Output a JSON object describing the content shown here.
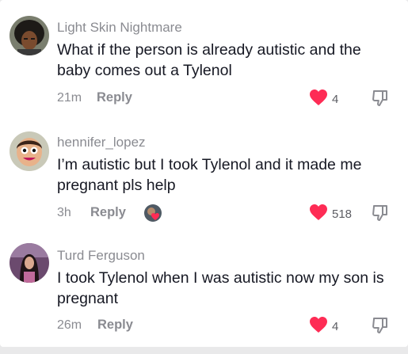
{
  "colors": {
    "like": "#fe2c55",
    "muted": "#8a8b91",
    "text": "#161823"
  },
  "comments": [
    {
      "username": "Light Skin Nightmare",
      "text": "What if the person is already autistic and the baby comes out a Tylenol",
      "time": "21m",
      "reply_label": "Reply",
      "likes": "4",
      "liked": true,
      "avatar_icon": "cartoon-avatar"
    },
    {
      "username": "hennifer_lopez",
      "text": "I’m autistic but I took Tylenol and it made me pregnant pls help",
      "time": "3h",
      "reply_label": "Reply",
      "likes": "518",
      "liked": true,
      "avatar_icon": "emoji-face-avatar",
      "creator_liked_icon": "creator-liked-avatar"
    },
    {
      "username": "Turd Ferguson",
      "text": "I took Tylenol when I was autistic now my son is pregnant",
      "time": "26m",
      "reply_label": "Reply",
      "likes": "4",
      "liked": true,
      "avatar_icon": "photo-avatar"
    }
  ]
}
